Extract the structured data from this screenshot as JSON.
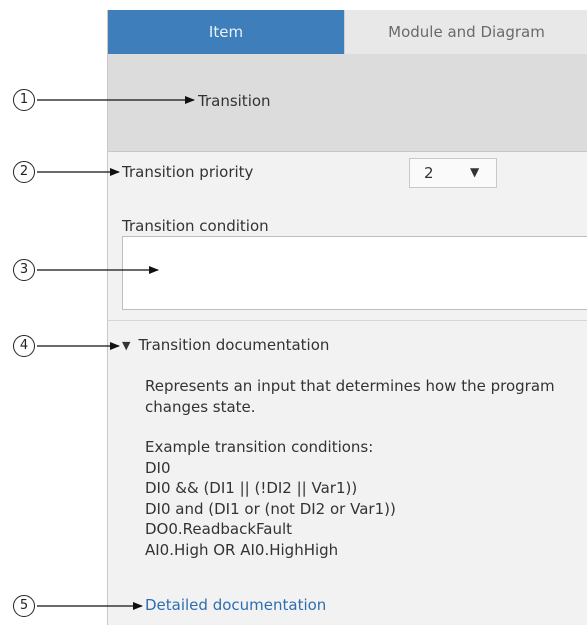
{
  "tabs": [
    {
      "label": "Item",
      "active": true
    },
    {
      "label": "Module and Diagram",
      "active": false
    }
  ],
  "header": {
    "title": "Transition"
  },
  "priority": {
    "label": "Transition priority",
    "value": "2"
  },
  "condition": {
    "label": "Transition condition",
    "value": ""
  },
  "documentation": {
    "toggle_label": "Transition documentation",
    "description": "Represents an input that determines how the program changes state.",
    "examples_heading": "Example transition conditions:",
    "examples": [
      "DI0",
      "DI0 && (DI1 || (!DI2 ||  Var1))",
      "DI0 and (DI1 or (not DI2 or Var1))",
      "DO0.ReadbackFault",
      "AI0.High OR AI0.HighHigh"
    ],
    "link_label": "Detailed documentation"
  },
  "callouts": [
    "1",
    "2",
    "3",
    "4",
    "5"
  ],
  "colors": {
    "active_tab": "#3d7ebb",
    "inactive_tab": "#e8e8e8",
    "panel": "#f2f2f2",
    "header_band": "#dcdcdc",
    "link": "#2e6db3"
  }
}
